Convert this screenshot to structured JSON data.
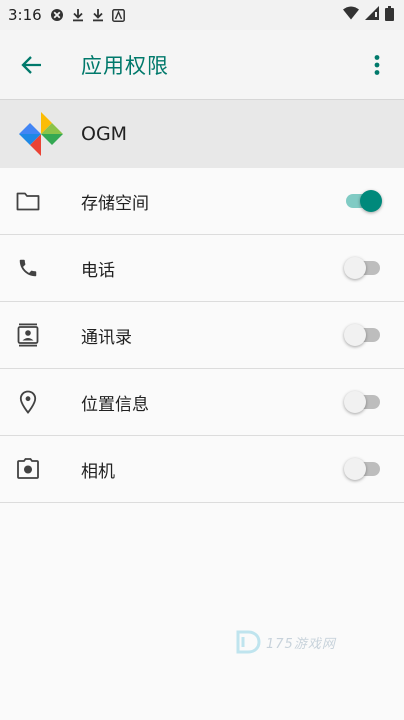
{
  "status_bar": {
    "time": "3:16"
  },
  "app_bar": {
    "title": "应用权限"
  },
  "app": {
    "name": "OGM"
  },
  "permissions": [
    {
      "label": "存储空间",
      "enabled": true
    },
    {
      "label": "电话",
      "enabled": false
    },
    {
      "label": "通讯录",
      "enabled": false
    },
    {
      "label": "位置信息",
      "enabled": false
    },
    {
      "label": "相机",
      "enabled": false
    }
  ],
  "watermark": {
    "text": "175游戏网"
  },
  "colors": {
    "accent": "#00796b",
    "toggle_on": "#00897b",
    "toggle_on_track": "#80cbc4"
  }
}
